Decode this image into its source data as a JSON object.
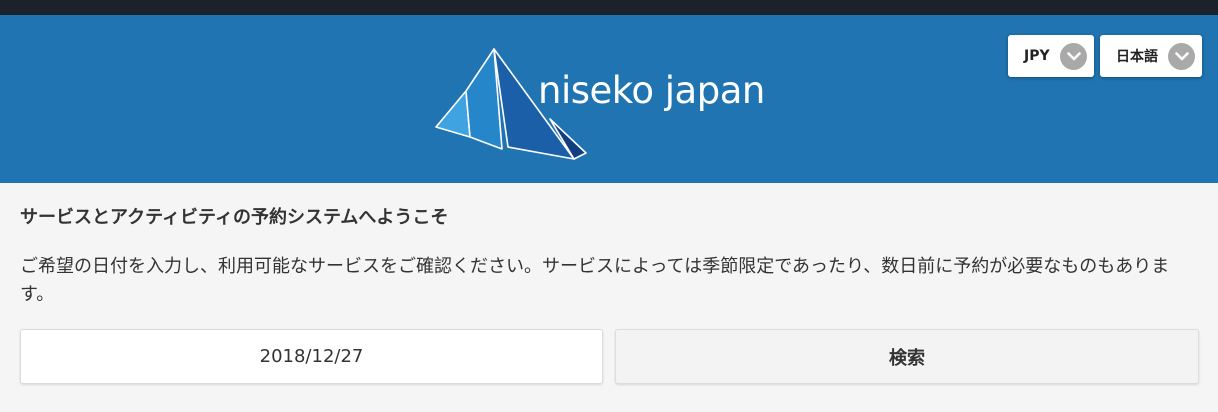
{
  "header": {
    "logo_text": "niseko japan",
    "currency_label": "JPY",
    "language_label": "日本語"
  },
  "main": {
    "title": "サービスとアクティビティの予約システムへようこそ",
    "description": "ご希望の日付を入力し、利用可能なサービスをご確認ください。サービスによっては季節限定であったり、数日前に予約が必要なものもあります。",
    "date_value": "2018/12/27",
    "search_label": "検索"
  },
  "colors": {
    "header_bg": "#1f74b1",
    "topbar_bg": "#1c2229"
  },
  "icons": [
    "niseko-logo-icon",
    "chevron-down-icon"
  ]
}
